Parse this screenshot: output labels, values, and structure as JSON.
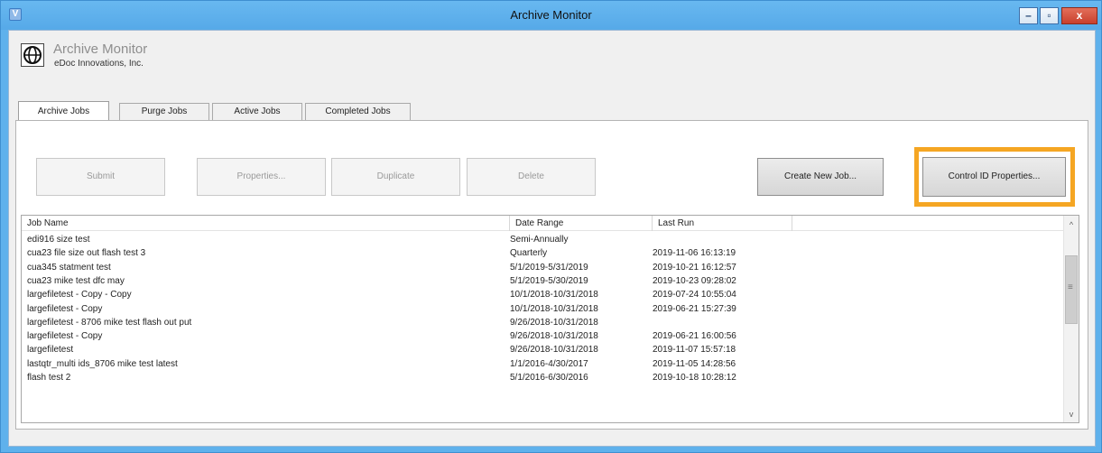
{
  "window": {
    "title": "Archive Monitor",
    "icon": "app-icon",
    "controls": {
      "minimize": "–",
      "maximize": "▫",
      "close": "x"
    }
  },
  "brand": {
    "logo": "globe-logo-icon",
    "title": "Archive Monitor",
    "subtitle": "eDoc Innovations, Inc."
  },
  "tabs": [
    {
      "label": "Archive Jobs",
      "active": true
    },
    {
      "label": "Purge Jobs",
      "active": false
    },
    {
      "label": "Active Jobs",
      "active": false
    },
    {
      "label": "Completed Jobs",
      "active": false
    }
  ],
  "toolbar": {
    "submit_label": "Submit",
    "properties_label": "Properties...",
    "duplicate_label": "Duplicate",
    "delete_label": "Delete",
    "create_new_label": "Create New Job...",
    "control_id_label": "Control ID Properties..."
  },
  "highlight_color": "#f5a623",
  "jobs_table": {
    "columns": [
      "Job Name",
      "Date Range",
      "Last Run"
    ],
    "rows": [
      [
        "edi916 size test",
        "Semi-Annually",
        ""
      ],
      [
        "cua23 file size out flash test 3",
        "Quarterly",
        "2019-11-06 16:13:19"
      ],
      [
        "cua345 statment test",
        "5/1/2019-5/31/2019",
        "2019-10-21 16:12:57"
      ],
      [
        "cua23 mike test dfc may",
        "5/1/2019-5/30/2019",
        "2019-10-23 09:28:02"
      ],
      [
        "largefiletest - Copy - Copy",
        "10/1/2018-10/31/2018",
        "2019-07-24 10:55:04"
      ],
      [
        "largefiletest - Copy",
        "10/1/2018-10/31/2018",
        "2019-06-21 15:27:39"
      ],
      [
        "largefiletest - 8706 mike test flash out put",
        "9/26/2018-10/31/2018",
        ""
      ],
      [
        "largefiletest - Copy",
        "9/26/2018-10/31/2018",
        "2019-06-21 16:00:56"
      ],
      [
        "largefiletest",
        "9/26/2018-10/31/2018",
        "2019-11-07 15:57:18"
      ],
      [
        "lastqtr_multi ids_8706 mike test latest",
        "1/1/2016-4/30/2017",
        "2019-11-05 14:28:56"
      ],
      [
        "flash test 2",
        "5/1/2016-6/30/2016",
        "2019-10-18 10:28:12"
      ]
    ]
  },
  "scrollbar": {
    "up": "^",
    "grip": "≡",
    "down": "v"
  }
}
